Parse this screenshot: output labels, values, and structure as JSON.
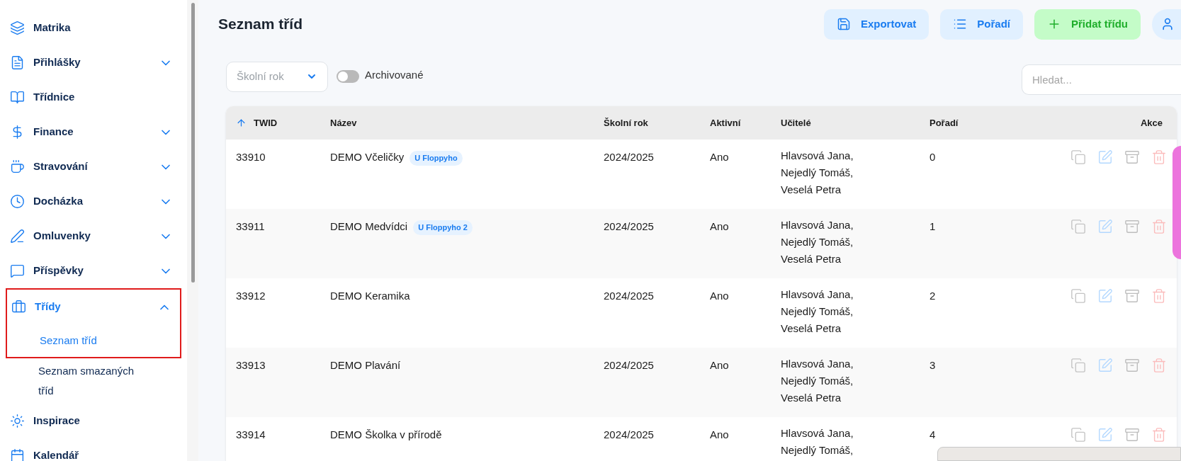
{
  "sidebar": {
    "items": [
      {
        "label": "Matrika",
        "selected": false
      },
      {
        "label": "Přihlášky",
        "expanded": false,
        "selected": false
      },
      {
        "label": "Třídnice",
        "selected": false
      },
      {
        "label": "Finance",
        "expanded": false,
        "selected": false
      },
      {
        "label": "Stravování",
        "expanded": false,
        "selected": false
      },
      {
        "label": "Docházka",
        "expanded": false,
        "selected": false
      },
      {
        "label": "Omluvenky",
        "expanded": false,
        "selected": false
      },
      {
        "label": "Příspěvky",
        "expanded": false,
        "selected": false
      },
      {
        "label": "Třídy",
        "expanded": true,
        "selected": true,
        "children": [
          {
            "label": "Seznam tříd",
            "selected": true
          },
          {
            "label": "Seznam smazaných tříd",
            "selected": false
          }
        ]
      },
      {
        "label": "Inspirace",
        "selected": false
      },
      {
        "label": "Kalendář",
        "selected": false
      }
    ]
  },
  "page_title": "Seznam tříd",
  "actions": [
    {
      "label": "Exportovat",
      "kind": "export"
    },
    {
      "label": "Pořadí",
      "kind": "order"
    },
    {
      "label": "Přidat třídu",
      "kind": "add"
    }
  ],
  "filters": {
    "school_year": {
      "placeholder": "Školní rok"
    },
    "archived": {
      "label": "Archivované",
      "on": false
    },
    "search": {
      "placeholder": "Hledat..."
    }
  },
  "table": {
    "columns": [
      "TWID",
      "Název",
      "Školní rok",
      "Aktivní",
      "Učitelé",
      "Pořadí",
      "Akce"
    ],
    "rows": [
      {
        "twid": "33910",
        "name": "DEMO Včeličky",
        "tag": "U Floppyho",
        "year": "2024/2025",
        "active": "Ano",
        "teachers": [
          "Hlavsová Jana,",
          "Nejedlý Tomáš,",
          "Veselá Petra"
        ],
        "order": "0"
      },
      {
        "twid": "33911",
        "name": "DEMO Medvídci",
        "tag": "U Floppyho 2",
        "year": "2024/2025",
        "active": "Ano",
        "teachers": [
          "Hlavsová Jana,",
          "Nejedlý Tomáš,",
          "Veselá Petra"
        ],
        "order": "1"
      },
      {
        "twid": "33912",
        "name": "DEMO Keramika",
        "year": "2024/2025",
        "active": "Ano",
        "teachers": [
          "Hlavsová Jana,",
          "Nejedlý Tomáš,",
          "Veselá Petra"
        ],
        "order": "2"
      },
      {
        "twid": "33913",
        "name": "DEMO Plavání",
        "year": "2024/2025",
        "active": "Ano",
        "teachers": [
          "Hlavsová Jana,",
          "Nejedlý Tomáš,",
          "Veselá Petra"
        ],
        "order": "3"
      },
      {
        "twid": "33914",
        "name": "DEMO Školka v přírodě",
        "year": "2024/2025",
        "active": "Ano",
        "teachers": [
          "Hlavsová Jana,",
          "Nejedlý Tomáš,"
        ],
        "order": "4"
      }
    ]
  }
}
